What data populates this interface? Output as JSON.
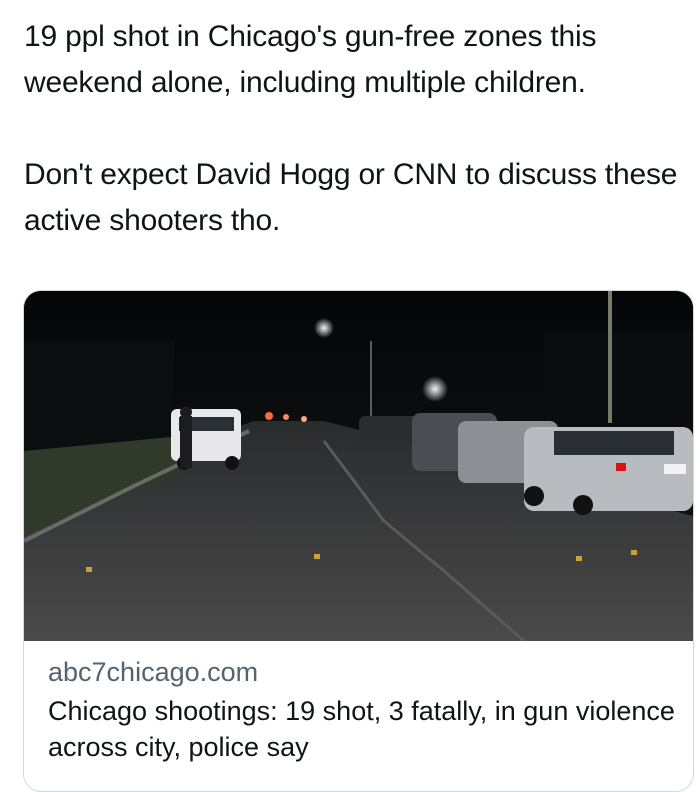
{
  "post": {
    "paragraph_1": "19 ppl shot in Chicago's gun-free zones this weekend alone, including multiple children.",
    "paragraph_2": "Don't expect David Hogg or CNN to discuss these active shooters tho."
  },
  "link_card": {
    "domain": "abc7chicago.com",
    "title": "Chicago shootings: 19 shot, 3 fatally, in gun violence across city, police say",
    "image_description_icon": "night-street-police-scene-image"
  },
  "colors": {
    "text_primary": "#0f1419",
    "text_secondary": "#536471",
    "card_border": "#cfd9de"
  }
}
